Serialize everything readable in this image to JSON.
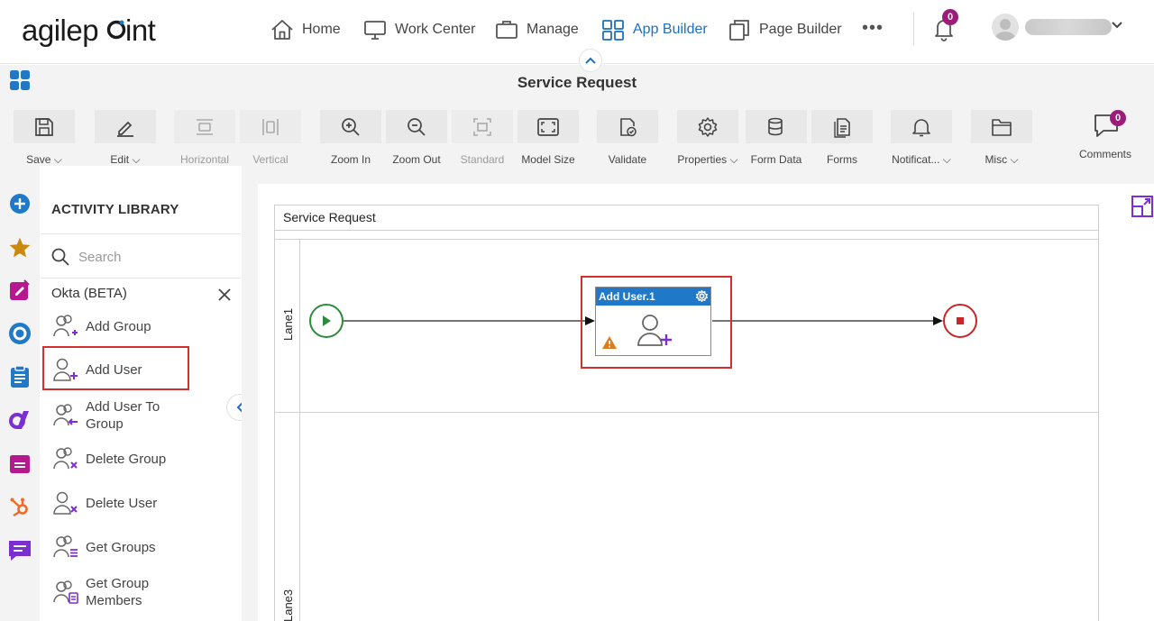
{
  "brand": {
    "logo_text": "agilepoint"
  },
  "topnav": {
    "items": [
      {
        "label": "Home",
        "icon": "home-icon"
      },
      {
        "label": "Work Center",
        "icon": "monitor-icon"
      },
      {
        "label": "Manage",
        "icon": "briefcase-icon"
      },
      {
        "label": "App Builder",
        "icon": "grid-icon",
        "active": true
      },
      {
        "label": "Page Builder",
        "icon": "pages-icon"
      }
    ],
    "more": "•••",
    "notification_count": "0"
  },
  "titlebar": {
    "title": "Service Request"
  },
  "toolbar": {
    "items": [
      {
        "label": "Save",
        "dropdown": true,
        "enabled": true
      },
      {
        "label": "Edit",
        "dropdown": true,
        "enabled": true
      },
      {
        "label": "Horizontal",
        "enabled": false
      },
      {
        "label": "Vertical",
        "enabled": false
      },
      {
        "label": "Zoom In",
        "enabled": true
      },
      {
        "label": "Zoom Out",
        "enabled": true
      },
      {
        "label": "Standard",
        "enabled": false
      },
      {
        "label": "Model Size",
        "enabled": true
      },
      {
        "label": "Validate",
        "enabled": true
      },
      {
        "label": "Properties",
        "dropdown": true,
        "enabled": true
      },
      {
        "label": "Form Data",
        "enabled": true
      },
      {
        "label": "Forms",
        "enabled": true
      },
      {
        "label": "Notificat...",
        "dropdown": true,
        "enabled": true
      },
      {
        "label": "Misc",
        "dropdown": true,
        "enabled": true
      }
    ],
    "comments_label": "Comments",
    "comments_count": "0"
  },
  "library": {
    "title": "ACTIVITY LIBRARY",
    "search_placeholder": "Search",
    "category": "Okta (BETA)",
    "items": [
      {
        "label": "Add Group"
      },
      {
        "label": "Add User"
      },
      {
        "label": "Add User To Group"
      },
      {
        "label": "Delete Group"
      },
      {
        "label": "Delete User"
      },
      {
        "label": "Get Groups"
      },
      {
        "label": "Get Group Members"
      }
    ]
  },
  "canvas": {
    "pool_title": "Service Request",
    "lanes": [
      "Lane1",
      "Lane3"
    ],
    "task": {
      "title": "Add User.1"
    }
  },
  "colors": {
    "accent": "#1f78c8",
    "badge": "#9c1c7a",
    "highlight": "#d32f2f",
    "start": "#2e8b3e",
    "end": "#c62828"
  }
}
